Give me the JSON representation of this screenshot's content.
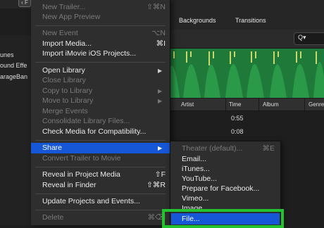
{
  "back_button": "‹ F",
  "browser_tabs": [
    "Backgrounds",
    "Transitions"
  ],
  "search_icon_glyph": "Q▾",
  "sidebar": [
    "unes",
    "ound Effe",
    "arageBan"
  ],
  "table": {
    "headers": [
      "Artist",
      "Time",
      "Album",
      "Genre"
    ],
    "rows": [
      {
        "time": "0:55"
      },
      {
        "time": "0:08"
      }
    ]
  },
  "menu": {
    "items": [
      {
        "label": "New Trailer...",
        "shortcut": "⇧⌘N",
        "enabled": false
      },
      {
        "label": "New App Preview",
        "shortcut": "",
        "enabled": false
      },
      {
        "label": "New Event",
        "shortcut": "⌥N",
        "enabled": false
      },
      {
        "label": "Import Media...",
        "shortcut": "⌘I",
        "enabled": true
      },
      {
        "label": "Import iMovie iOS Projects...",
        "shortcut": "",
        "enabled": true
      },
      {
        "label": "Open Library",
        "shortcut": "",
        "enabled": true,
        "submenu": true
      },
      {
        "label": "Close Library",
        "shortcut": "",
        "enabled": false
      },
      {
        "label": "Copy to Library",
        "shortcut": "",
        "enabled": false,
        "submenu": true
      },
      {
        "label": "Move to Library",
        "shortcut": "",
        "enabled": false,
        "submenu": true
      },
      {
        "label": "Merge Events",
        "shortcut": "",
        "enabled": false
      },
      {
        "label": "Consolidate Library Files...",
        "shortcut": "",
        "enabled": false
      },
      {
        "label": "Check Media for Compatibility...",
        "shortcut": "",
        "enabled": true
      },
      {
        "label": "Share",
        "shortcut": "",
        "enabled": true,
        "submenu": true,
        "highlighted": true
      },
      {
        "label": "Convert Trailer to Movie",
        "shortcut": "",
        "enabled": false
      },
      {
        "label": "Reveal in Project Media",
        "shortcut": "⇧F",
        "enabled": true
      },
      {
        "label": "Reveal in Finder",
        "shortcut": "⇧⌘R",
        "enabled": true
      },
      {
        "label": "Update Projects and Events...",
        "shortcut": "",
        "enabled": true
      },
      {
        "label": "Delete",
        "shortcut": "⌘⌫",
        "enabled": false
      }
    ],
    "arrow_glyph": "▶"
  },
  "share_submenu": {
    "items": [
      {
        "label": "Theater (default)...",
        "shortcut": "⌘E",
        "enabled": false
      },
      {
        "label": "Email...",
        "enabled": true
      },
      {
        "label": "iTunes...",
        "enabled": true
      },
      {
        "label": "YouTube...",
        "enabled": true
      },
      {
        "label": "Prepare for Facebook...",
        "enabled": true
      },
      {
        "label": "Vimeo...",
        "enabled": true
      },
      {
        "label": "Image...",
        "enabled": true
      },
      {
        "label": "File...",
        "enabled": true,
        "highlighted": true
      }
    ]
  },
  "colors": {
    "highlight": "#1557d6",
    "annotation_box": "#22c32e",
    "waveform_bg": "#1f7a3a",
    "waveform_peak": "#c8d86a"
  }
}
